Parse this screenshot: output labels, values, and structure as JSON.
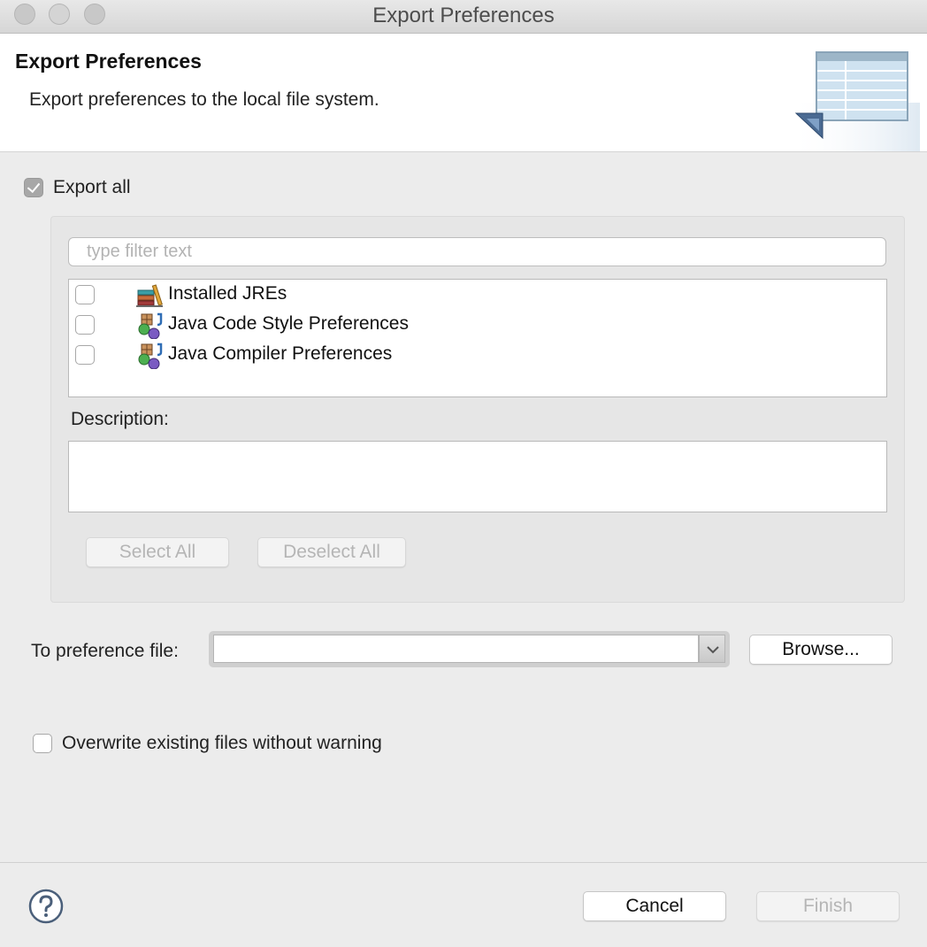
{
  "window": {
    "title": "Export Preferences"
  },
  "banner": {
    "title": "Export Preferences",
    "description": "Export preferences to the local file system.",
    "icon": "export-wizard-banner-icon"
  },
  "export_all": {
    "label": "Export all",
    "checked": true
  },
  "filter": {
    "placeholder": "type filter text",
    "value": ""
  },
  "preferences_list": {
    "items": [
      {
        "label": "Installed JREs",
        "checked": false,
        "icon": "jre-library-icon"
      },
      {
        "label": "Java Code Style Preferences",
        "checked": false,
        "icon": "java-preferences-icon"
      },
      {
        "label": "Java Compiler Preferences",
        "checked": false,
        "icon": "java-preferences-icon"
      }
    ]
  },
  "description": {
    "label": "Description:",
    "value": ""
  },
  "selection_buttons": {
    "select_all": "Select All",
    "deselect_all": "Deselect All"
  },
  "preference_file": {
    "label": "To preference file:",
    "value": "",
    "browse": "Browse..."
  },
  "overwrite": {
    "label": "Overwrite existing files without warning",
    "checked": false
  },
  "footer": {
    "help_icon": "help-icon",
    "cancel": "Cancel",
    "finish": "Finish"
  },
  "colors": {
    "disabled_text": "#b5b5b5",
    "background": "#ececec",
    "group_background": "#e6e6e6"
  }
}
